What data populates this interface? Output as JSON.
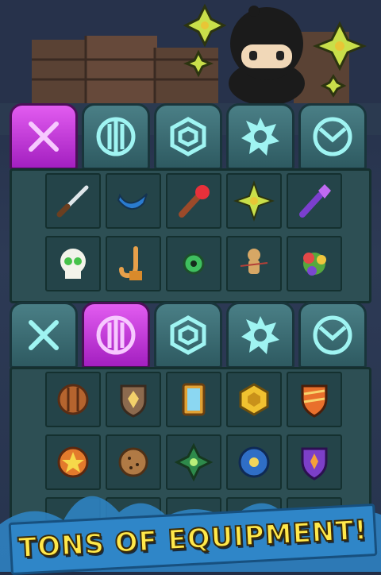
{
  "banner": {
    "text": "TONS OF EQUIPMENT!"
  },
  "colors": {
    "active_tab": "#c43ad8",
    "tab": "#3f7077",
    "grid_bg": "#2d4f54",
    "cell_bg": "#244449",
    "banner_bg": "#2f86c8",
    "banner_text": "#ffe84a"
  },
  "top_panel": {
    "active_tab": "weapons",
    "tabs": [
      "swords-icon",
      "round-shield-icon",
      "gem-icon",
      "saw-blade-icon",
      "armor-icon"
    ],
    "items": [
      "dagger-icon",
      "boomerang-icon",
      "torch-icon",
      "shuriken-icon",
      "purple-staff-icon",
      "skull-icon",
      "hook-icon",
      "green-orb-icon",
      "voodoo-doll-icon",
      "spiked-gear-icon"
    ]
  },
  "bottom_panel": {
    "active_tab": "shields",
    "tabs": [
      "swords-icon",
      "round-shield-icon",
      "gem-icon",
      "saw-blade-icon",
      "armor-icon"
    ],
    "items": [
      "wooden-round-shield-icon",
      "crest-shield-icon",
      "mirror-shield-icon",
      "hex-gold-shield-icon",
      "striped-shield-icon",
      "star-shield-icon",
      "cookie-shield-icon",
      "green-star-shield-icon",
      "blue-round-shield-icon",
      "purple-crest-shield-icon"
    ]
  }
}
